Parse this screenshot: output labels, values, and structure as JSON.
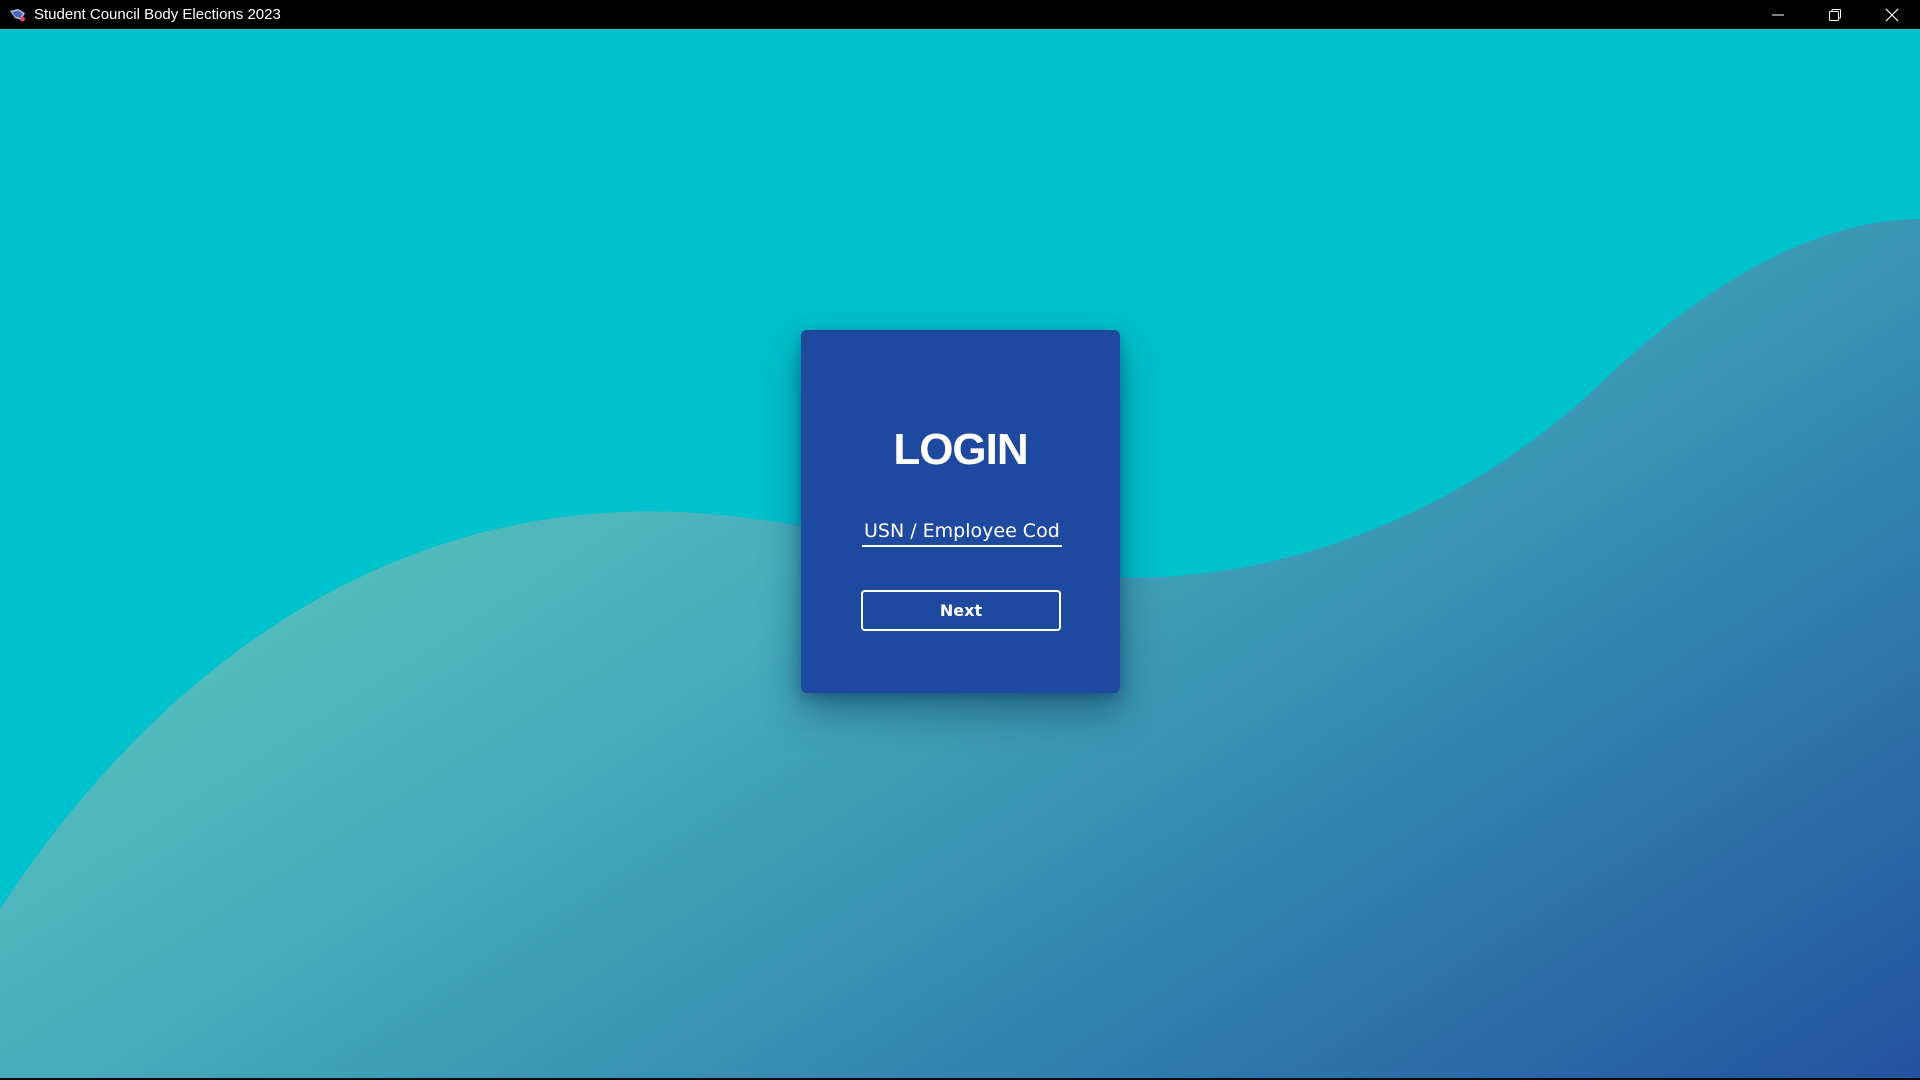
{
  "window": {
    "title": "Student Council Body Elections 2023",
    "app_icon": "app-logo-icon",
    "controls": [
      "minimize-icon",
      "restore-icon",
      "close-icon"
    ]
  },
  "colors": {
    "background_top": "#00c2cc",
    "wave_light": "#5dcbbd",
    "wave_dark": "#2452a0",
    "card": "#1d4a9e",
    "text": "#ffffff"
  },
  "login": {
    "title": "LOGIN",
    "usn_field": {
      "placeholder": "USN / Employee Code",
      "value": ""
    },
    "next_label": "Next"
  }
}
